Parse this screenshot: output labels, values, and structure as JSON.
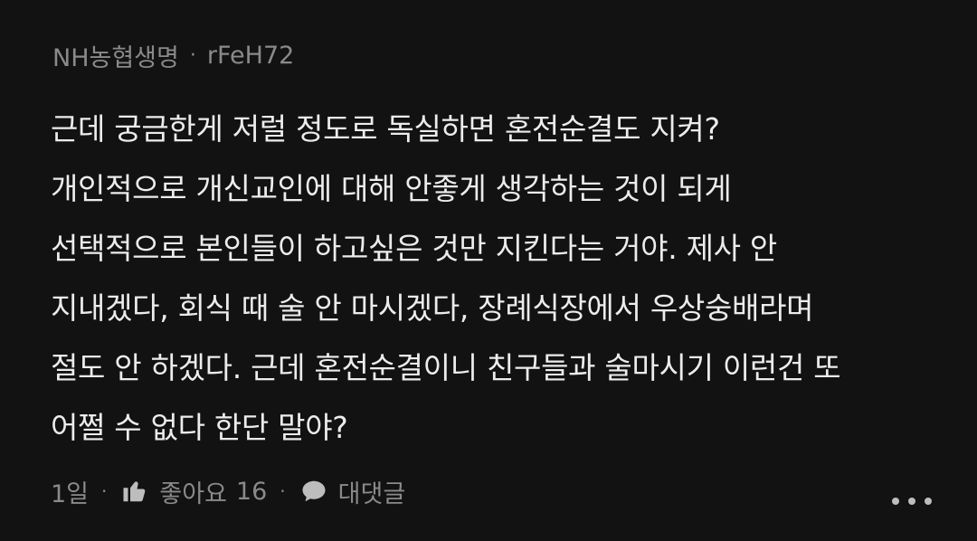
{
  "comment": {
    "author": "NH농협생명",
    "user_id": "rFeH72",
    "separator": "·",
    "lines": [
      "근데 궁금한게 저럴 정도로 독실하면 혼전순결도 지켜?",
      "개인적으로 개신교인에 대해 안좋게 생각하는 것이 되게",
      "선택적으로 본인들이 하고싶은 것만 지킨다는 거야. 제사 안",
      "지내겠다, 회식 때 술 안 마시겠다, 장례식장에서 우상숭배라며",
      "절도 안 하겠다. 근데 혼전순결이니 친구들과 술마시기 이런건 또",
      "어쩔 수 없다 한단 말야?"
    ],
    "footer": {
      "time": "1일",
      "sep": "·",
      "like_label": "좋아요",
      "like_count": "16",
      "reply_label": "대댓글"
    },
    "icons": {
      "like": "thumbs-up-icon",
      "reply": "speech-bubble-icon",
      "more": "more-dots-icon"
    }
  }
}
